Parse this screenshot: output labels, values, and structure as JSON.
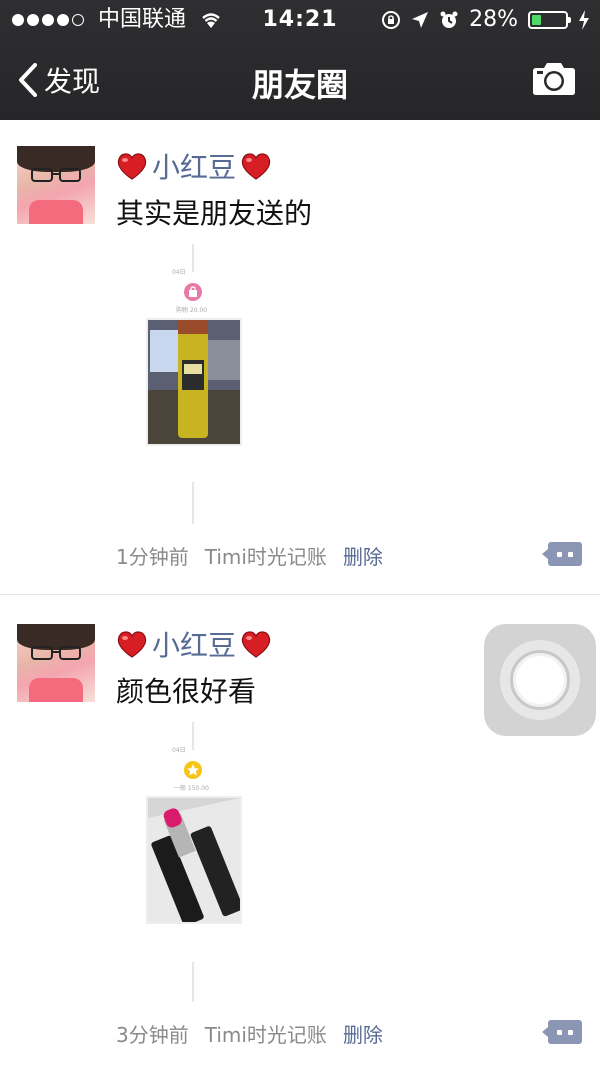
{
  "status_bar": {
    "carrier": "中国联通",
    "time": "14:21",
    "battery": "28%",
    "battery_level": 0.28
  },
  "nav": {
    "back_label": "发现",
    "title": "朋友圈"
  },
  "posts": [
    {
      "name": "小红豆",
      "text": "其实是朋友送的",
      "timeline_date": "04日",
      "timeline_caption": "购物 20.00",
      "time_ago": "1分钟前",
      "source": "Timi时光记账",
      "delete_label": "删除",
      "icon_color": "#e87aa8"
    },
    {
      "name": "小红豆",
      "text": "颜色很好看",
      "timeline_date": "04日",
      "timeline_caption": "一般 150.00",
      "time_ago": "3分钟前",
      "source": "Timi时光记账",
      "delete_label": "删除",
      "icon_color": "#f5c518"
    }
  ]
}
